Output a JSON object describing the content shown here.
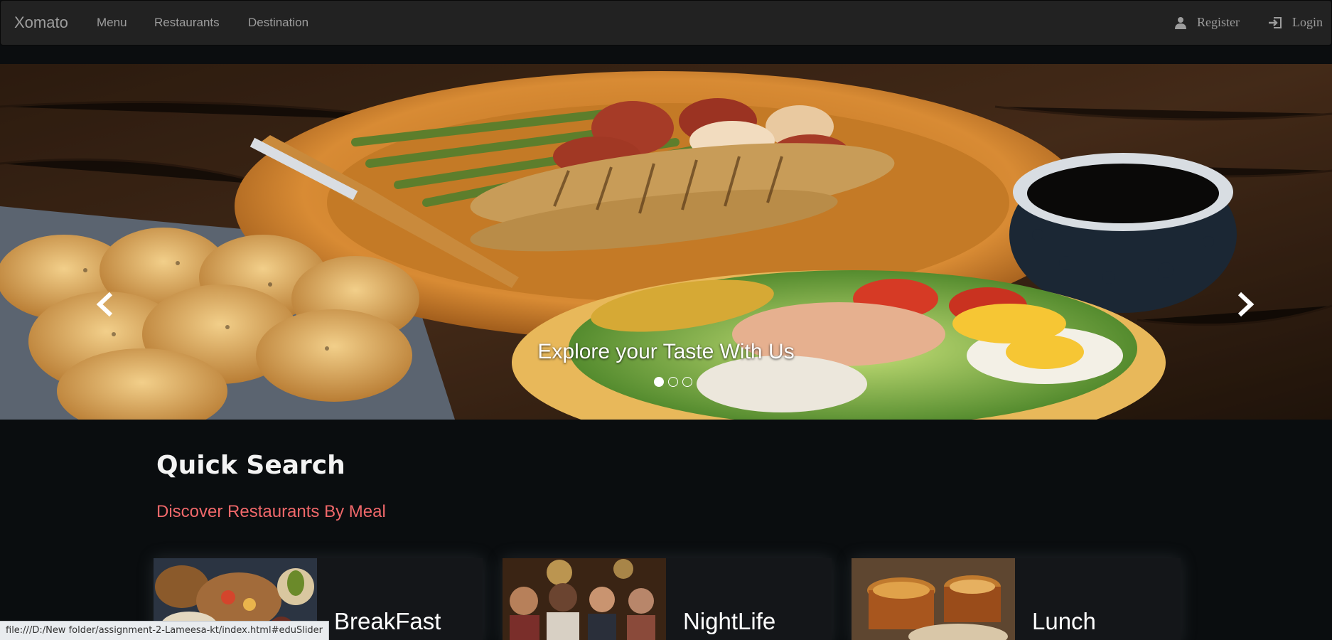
{
  "navbar": {
    "brand": "Xomato",
    "links": [
      "Menu",
      "Restaurants",
      "Destination"
    ],
    "register": "Register",
    "login": "Login"
  },
  "carousel": {
    "caption": "Explore your Taste With Us",
    "slide_count": 3,
    "active_slide": 1
  },
  "quick_search": {
    "title": "Quick Search",
    "subtitle": "Discover Restaurants By Meal",
    "cards": [
      {
        "label": "BreakFast"
      },
      {
        "label": "NightLife"
      },
      {
        "label": "Lunch"
      }
    ]
  },
  "status_bar": {
    "url": "file:///D:/New folder/assignment-2-Lameesa-kt/index.html#eduSlider"
  },
  "colors": {
    "navbar_bg": "#222222",
    "page_bg": "#0a0d0f",
    "subtitle": "#f0686a"
  }
}
